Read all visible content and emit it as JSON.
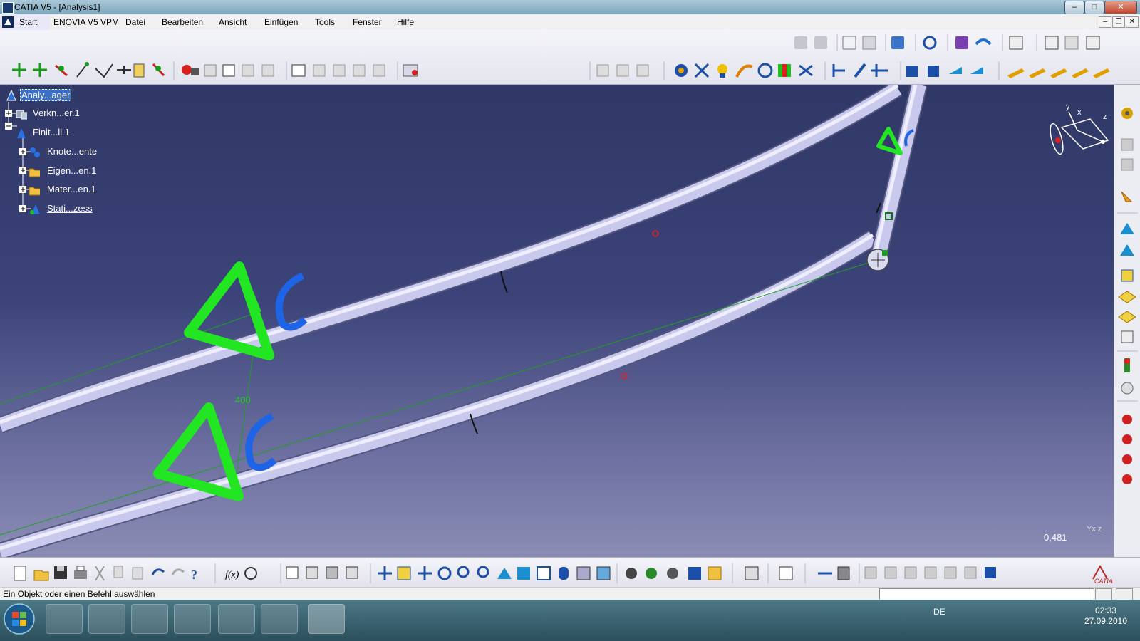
{
  "window": {
    "title": "CATIA V5 - [Analysis1]"
  },
  "menubar": {
    "items": [
      "Start",
      "ENOVIA V5 VPM",
      "Datei",
      "Bearbeiten",
      "Ansicht",
      "Einfügen",
      "Tools",
      "Fenster",
      "Hilfe"
    ]
  },
  "tree": {
    "items": [
      {
        "label": "Analy...ager",
        "icon": "analysis-manager-icon",
        "selected": true
      },
      {
        "label": "Verkn...er.1",
        "icon": "links-manager-icon"
      },
      {
        "label": "Finit...ll.1",
        "icon": "finite-element-model-icon"
      },
      {
        "label": "Knote...ente",
        "icon": "nodes-elements-icon"
      },
      {
        "label": "Eigen...en.1",
        "icon": "properties-folder-icon"
      },
      {
        "label": "Mater...en.1",
        "icon": "materials-folder-icon"
      },
      {
        "label": "Stati...zess",
        "icon": "static-case-icon",
        "underlined": true
      }
    ]
  },
  "viewport": {
    "dimension_label": "400",
    "zoom_readout": "0,481",
    "compass_axes": {
      "x": "x",
      "y": "y",
      "z": "z"
    },
    "mini_axis_label": "Yx z"
  },
  "statusbar": {
    "message": "Ein Objekt oder einen Befehl auswählen",
    "command_value": ""
  },
  "taskbar": {
    "language": "DE",
    "time": "02:33",
    "date": "27.09.2010"
  },
  "colors": {
    "viewport_top": "#303866",
    "viewport_bottom": "#8b8db5",
    "tube": "#c9c9ee",
    "restraint_green": "#22e622",
    "restraint_blue": "#1e64e6",
    "selection": "#3b6fc7"
  }
}
